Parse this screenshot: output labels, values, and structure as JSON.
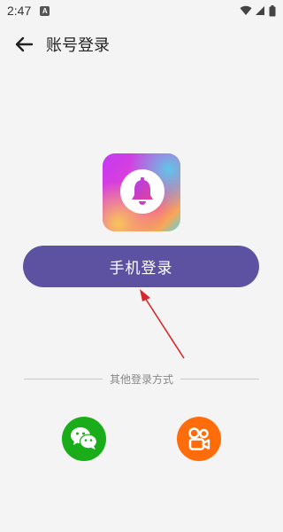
{
  "status_bar": {
    "time": "2:47",
    "notification_letter": "A"
  },
  "header": {
    "title": "账号登录",
    "back_icon": "arrow-left-icon"
  },
  "app_icon": {
    "icon": "bell-icon",
    "gradient_colors": [
      "#c23af5",
      "#e13fd3",
      "#f05a9d",
      "#f6a856",
      "#55d7e6"
    ]
  },
  "login": {
    "phone_login_label": "手机登录",
    "button_color": "#5d52a2"
  },
  "other_methods": {
    "divider_label": "其他登录方式",
    "options": [
      {
        "icon": "wechat-icon",
        "color": "#1aad19"
      },
      {
        "icon": "kuaishou-icon",
        "color": "#ff6c0a"
      }
    ]
  },
  "annotation": {
    "arrow_color": "#d6282c"
  }
}
